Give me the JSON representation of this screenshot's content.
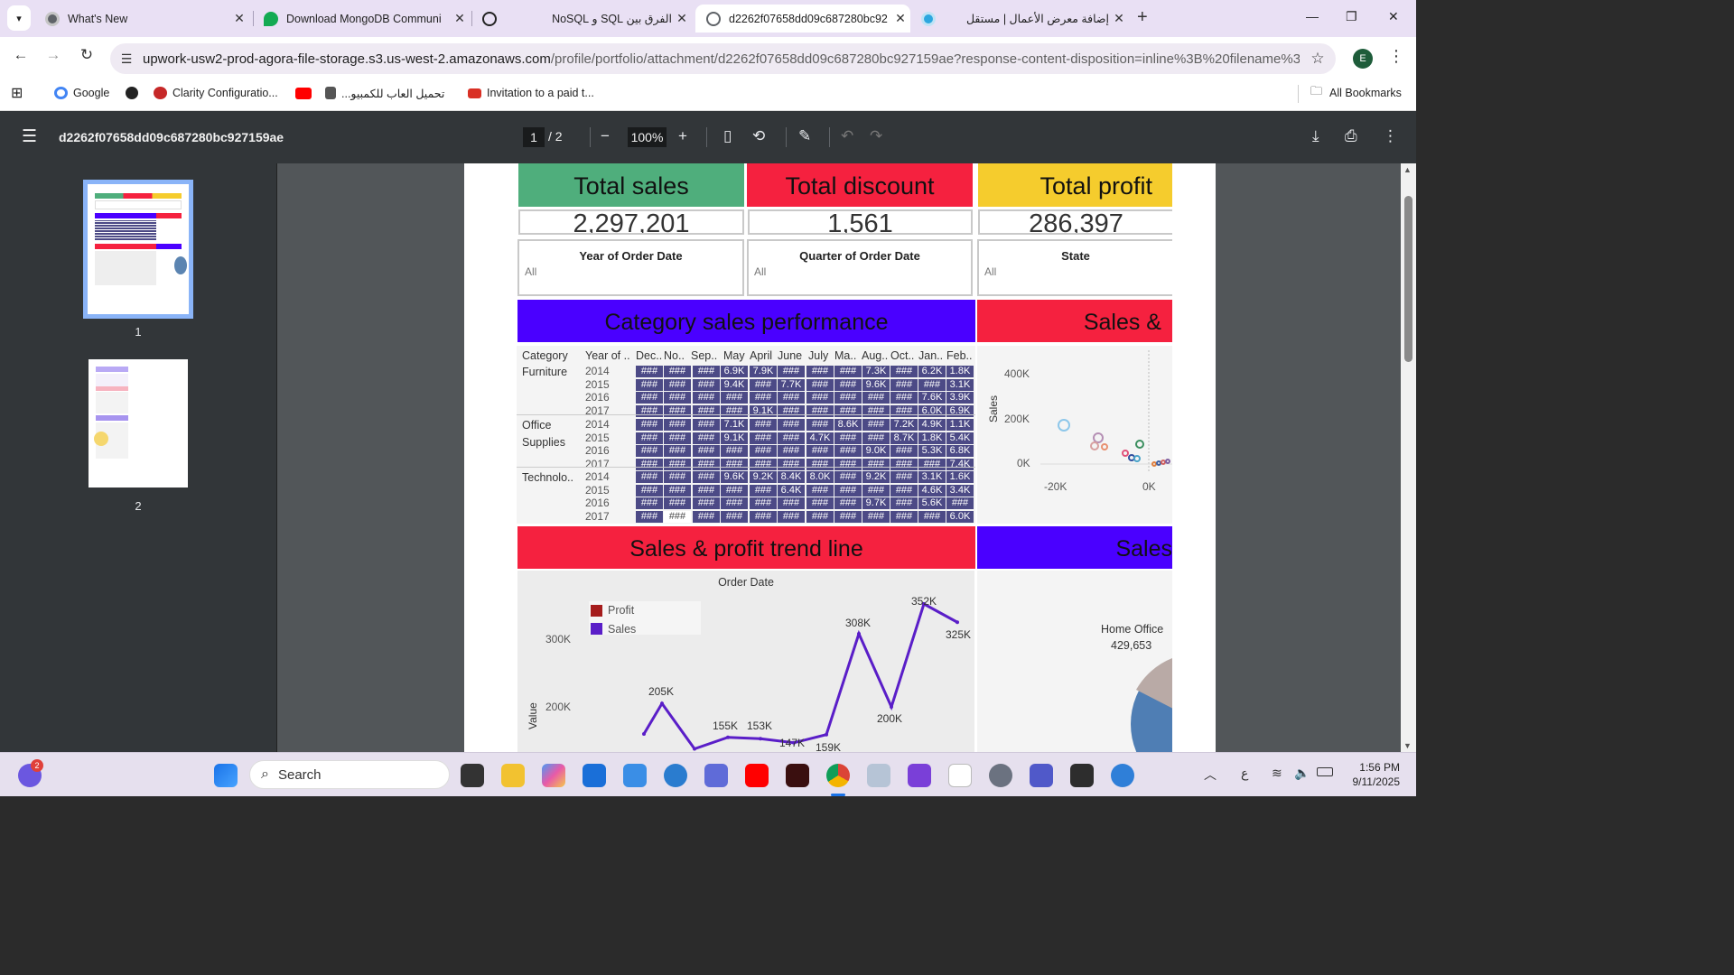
{
  "tabs": [
    {
      "label": "What's New",
      "icon": "chrome-icon",
      "color": "#5f6368"
    },
    {
      "label": "Download MongoDB Communi",
      "icon": "mongodb-leaf-icon",
      "color": "#13aa52"
    },
    {
      "label": "الفرق بين SQL و NoSQL",
      "icon": "openai-icon",
      "color": "#222222"
    },
    {
      "label": "d2262f07658dd09c687280bc92",
      "icon": "globe-icon",
      "color": "#5f6368"
    },
    {
      "label": "إضافة معرض الأعمال | مستقل",
      "icon": "mostaql-icon",
      "color": "#2ca7df"
    }
  ],
  "address": {
    "host": "upwork-usw2-prod-agora-file-storage.s3.us-west-2.amazonaws.com",
    "path": "/profile/portfolio/attachment/d2262f07658dd09c687280bc927159ae?response-content-disposition=inline%3B%20filename%3D\"Sal..."
  },
  "profile_initial": "E",
  "bookmarks": [
    {
      "label": "Google",
      "icon": "google-icon",
      "color": "#4285f4"
    },
    {
      "label": "",
      "icon": "globe-icon",
      "color": "#222222"
    },
    {
      "label": "Clarity Configuratio...",
      "icon": "clarity-icon",
      "color": "#c62828"
    },
    {
      "label": "",
      "icon": "youtube-icon",
      "color": "#ff0000"
    },
    {
      "label": "تحميل العاب للكمبيو...",
      "icon": "games-icon",
      "color": "#555555"
    },
    {
      "label": "Invitation to a paid t...",
      "icon": "gmail-icon",
      "color": "#d93025"
    }
  ],
  "all_bookmarks": "All Bookmarks",
  "pdf": {
    "filename": "d2262f07658dd09c687280bc927159ae",
    "page_current": "1",
    "page_total": "/  2",
    "zoom": "100%",
    "thumb_labels": [
      "1",
      "2"
    ]
  },
  "dashboard": {
    "kpis": [
      {
        "title": "Total sales",
        "value": "2,297,201",
        "color": "#4fae7c"
      },
      {
        "title": "Total discount",
        "value": "1,561",
        "color": "#f5213f"
      },
      {
        "title": "Total profit",
        "value": "286,397",
        "color": "#f5cc2d"
      }
    ],
    "filters": [
      {
        "title": "Year of Order Date",
        "value": "All"
      },
      {
        "title": "Quarter of Order Date",
        "value": "All"
      },
      {
        "title": "State",
        "value": "All"
      }
    ],
    "bands": [
      {
        "title": "Category sales performance",
        "color": "#4a00ff"
      },
      {
        "title": "Sales &",
        "color": "#f5213f"
      },
      {
        "title": "Sales & profit trend line",
        "color": "#f5213f"
      },
      {
        "title": "Sales",
        "color": "#4a00ff"
      }
    ],
    "heatmap": {
      "headers": [
        "Category",
        "Year of ..",
        "Dec..",
        "No..",
        "Sep..",
        "May",
        "April",
        "June",
        "July",
        "Ma..",
        "Aug..",
        "Oct..",
        "Jan..",
        "Feb.."
      ],
      "categories": [
        {
          "name": "Furniture",
          "rows": [
            {
              "year": "2014",
              "cells": [
                "###",
                "###",
                "###",
                "6.9K",
                "7.9K",
                "###",
                "###",
                "###",
                "7.3K",
                "###",
                "6.2K",
                "1.8K"
              ]
            },
            {
              "year": "2015",
              "cells": [
                "###",
                "###",
                "###",
                "9.4K",
                "###",
                "7.7K",
                "###",
                "###",
                "9.6K",
                "###",
                "###",
                "3.1K"
              ]
            },
            {
              "year": "2016",
              "cells": [
                "###",
                "###",
                "###",
                "###",
                "###",
                "###",
                "###",
                "###",
                "###",
                "###",
                "7.6K",
                "3.9K"
              ]
            },
            {
              "year": "2017",
              "cells": [
                "###",
                "###",
                "###",
                "###",
                "9.1K",
                "###",
                "###",
                "###",
                "###",
                "###",
                "6.0K",
                "6.9K"
              ]
            }
          ]
        },
        {
          "name": "Office Supplies",
          "rows": [
            {
              "year": "2014",
              "cells": [
                "###",
                "###",
                "###",
                "7.1K",
                "###",
                "###",
                "###",
                "8.6K",
                "###",
                "7.2K",
                "4.9K",
                "1.1K"
              ]
            },
            {
              "year": "2015",
              "cells": [
                "###",
                "###",
                "###",
                "9.1K",
                "###",
                "###",
                "4.7K",
                "###",
                "###",
                "8.7K",
                "1.8K",
                "5.4K"
              ]
            },
            {
              "year": "2016",
              "cells": [
                "###",
                "###",
                "###",
                "###",
                "###",
                "###",
                "###",
                "###",
                "9.0K",
                "###",
                "5.3K",
                "6.8K"
              ]
            },
            {
              "year": "2017",
              "cells": [
                "###",
                "###",
                "###",
                "###",
                "###",
                "###",
                "###",
                "###",
                "###",
                "###",
                "###",
                "7.4K"
              ]
            }
          ]
        },
        {
          "name": "Technolo..",
          "rows": [
            {
              "year": "2014",
              "cells": [
                "###",
                "###",
                "###",
                "9.6K",
                "9.2K",
                "8.4K",
                "8.0K",
                "###",
                "9.2K",
                "###",
                "3.1K",
                "1.6K"
              ]
            },
            {
              "year": "2015",
              "cells": [
                "###",
                "###",
                "###",
                "###",
                "###",
                "6.4K",
                "###",
                "###",
                "###",
                "###",
                "4.6K",
                "3.4K"
              ]
            },
            {
              "year": "2016",
              "cells": [
                "###",
                "###",
                "###",
                "###",
                "###",
                "###",
                "###",
                "###",
                "9.7K",
                "###",
                "5.6K",
                "###"
              ]
            },
            {
              "year": "2017",
              "cells": [
                "###",
                "###",
                "###",
                "###",
                "###",
                "###",
                "###",
                "###",
                "###",
                "###",
                "###",
                "6.0K"
              ]
            }
          ]
        }
      ]
    },
    "scatter": {
      "ylabel": "Sales",
      "yticks": [
        "400K",
        "200K",
        "0K"
      ],
      "xticks": [
        "-20K",
        "0K"
      ]
    },
    "trend": {
      "title": "Order Date",
      "ylabel": "Value",
      "legend": [
        {
          "name": "Profit",
          "color": "#a51c1c"
        },
        {
          "name": "Sales",
          "color": "#5a1ec8"
        }
      ],
      "yticks": [
        "300K",
        "200K"
      ],
      "labels": [
        "205K",
        "155K",
        "153K",
        "147K",
        "159K",
        "308K",
        "200K",
        "352K",
        "325K"
      ]
    },
    "segment": {
      "label": "Home Office",
      "value": "429,653"
    }
  },
  "chart_data": {
    "type": "line",
    "title": "Order Date",
    "ylabel": "Value",
    "series": [
      {
        "name": "Sales",
        "values": [
          160,
          205,
          138,
          155,
          153,
          147,
          159,
          308,
          200,
          352,
          325
        ]
      }
    ],
    "units": "K",
    "yticks": [
      200,
      300
    ]
  },
  "taskbar": {
    "search_placeholder": "Search",
    "notification_count": "2",
    "time": "1:56 PM",
    "date": "9/11/2025",
    "lang": "ع"
  }
}
